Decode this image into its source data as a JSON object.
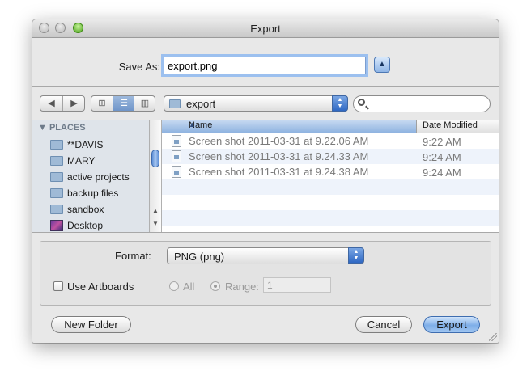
{
  "window": {
    "title": "Export"
  },
  "save_as": {
    "label": "Save As:",
    "value": "export.png",
    "disclosure_icon": "triangle-up-icon"
  },
  "toolbar": {
    "nav": [
      "◀",
      "▶"
    ],
    "view_modes": [
      "icon-view-icon",
      "list-view-icon",
      "column-view-icon"
    ],
    "location": "export",
    "search_value": ""
  },
  "sidebar": {
    "section": "PLACES",
    "items": [
      {
        "label": "**DAVIS",
        "icon": "folder-icon"
      },
      {
        "label": "MARY",
        "icon": "folder-icon"
      },
      {
        "label": "active projects",
        "icon": "folder-icon"
      },
      {
        "label": "backup files",
        "icon": "folder-icon"
      },
      {
        "label": "sandbox",
        "icon": "folder-icon"
      },
      {
        "label": "Desktop",
        "icon": "desktop-icon"
      }
    ]
  },
  "file_list": {
    "columns": [
      "Name",
      "Date Modified"
    ],
    "rows": [
      {
        "name": "Screen shot 2011-03-31 at 9.22.06 AM",
        "date": "9:22 AM"
      },
      {
        "name": "Screen shot 2011-03-31 at 9.24.33 AM",
        "date": "9:24 AM"
      },
      {
        "name": "Screen shot 2011-03-31 at 9.24.38 AM",
        "date": "9:24 AM"
      }
    ]
  },
  "options": {
    "format_label": "Format:",
    "format_value": "PNG (png)",
    "use_artboards": "Use Artboards",
    "all_label": "All",
    "range_label": "Range:",
    "range_value": "1"
  },
  "buttons": {
    "new_folder": "New Folder",
    "cancel": "Cancel",
    "export": "Export"
  },
  "colors": {
    "accent": "#6f95c9",
    "default_button": "#7eaee8"
  }
}
